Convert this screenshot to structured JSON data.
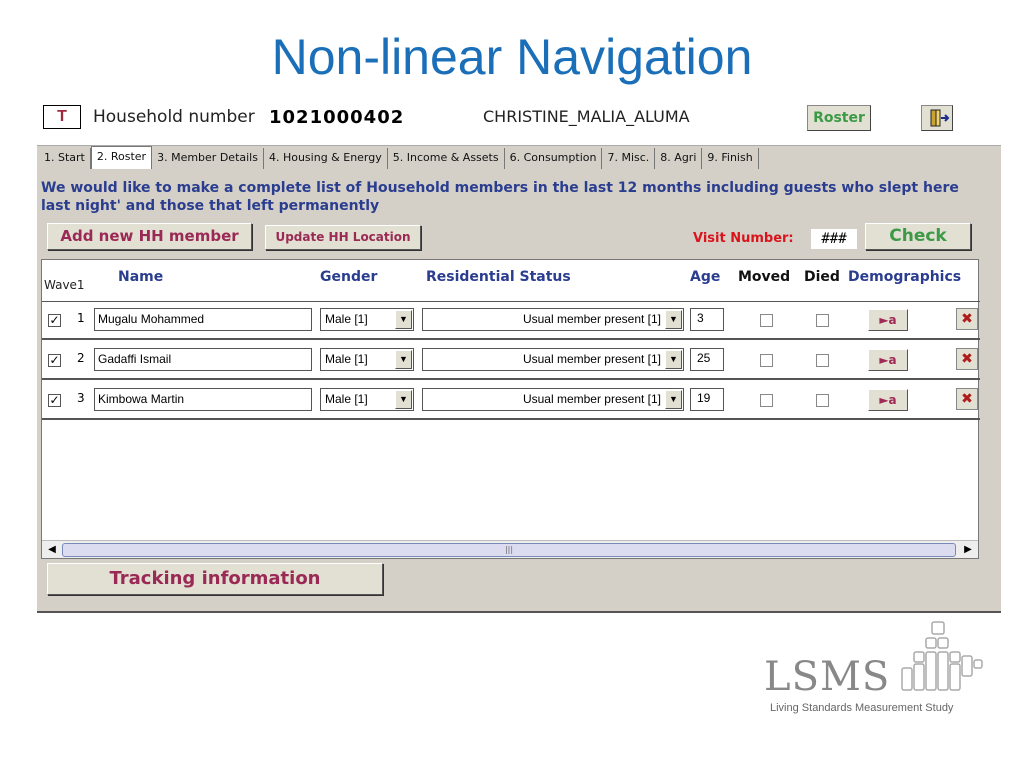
{
  "slide": {
    "title": "Non-linear Navigation"
  },
  "header": {
    "t_label": "T",
    "household_label": "Household number",
    "household_number": "1021000402",
    "household_name": "CHRISTINE_MALIA_ALUMA",
    "roster_button": "Roster",
    "exit_icon": "exit-door-icon"
  },
  "tabs": [
    {
      "label": "1. Start"
    },
    {
      "label": "2. Roster",
      "active": true
    },
    {
      "label": "3. Member Details"
    },
    {
      "label": "4. Housing & Energy"
    },
    {
      "label": "5. Income & Assets"
    },
    {
      "label": "6. Consumption"
    },
    {
      "label": "7. Misc."
    },
    {
      "label": "8. Agri"
    },
    {
      "label": "9. Finish"
    }
  ],
  "main": {
    "intro": "We would like to make a complete list of Household members in the last 12 months including guests who slept here last night' and those that left permanently",
    "add_button": "Add new HH member",
    "update_button": "Update HH Location",
    "visit_label": "Visit Number:",
    "visit_value": "###",
    "check_button": "Check",
    "tracking_button": "Tracking information"
  },
  "grid": {
    "headers": {
      "wave": "Wave1",
      "name": "Name",
      "gender": "Gender",
      "residential": "Residential Status",
      "age": "Age",
      "moved": "Moved",
      "died": "Died",
      "demographics": "Demographics"
    },
    "rows": [
      {
        "num": "1",
        "name": "Mugalu Mohammed",
        "gender": "Male  [1]",
        "residential": "Usual member present  [1]",
        "age": "3",
        "demo": "►a"
      },
      {
        "num": "2",
        "name": "Gadaffi Ismail",
        "gender": "Male  [1]",
        "residential": "Usual member present  [1]",
        "age": "25",
        "demo": "►a"
      },
      {
        "num": "3",
        "name": "Kimbowa Martin",
        "gender": "Male  [1]",
        "residential": "Usual member present  [1]",
        "age": "19",
        "demo": "►a"
      }
    ]
  },
  "logo": {
    "text": "LSMS",
    "subtitle": "Living Standards Measurement Study"
  },
  "colors": {
    "title_blue": "#1a6fb8",
    "label_navy": "#2a3d8f",
    "maroon": "#9a2a55",
    "green": "#3c9a47",
    "red": "#d8141c",
    "panel_gray": "#d4d0c8"
  }
}
